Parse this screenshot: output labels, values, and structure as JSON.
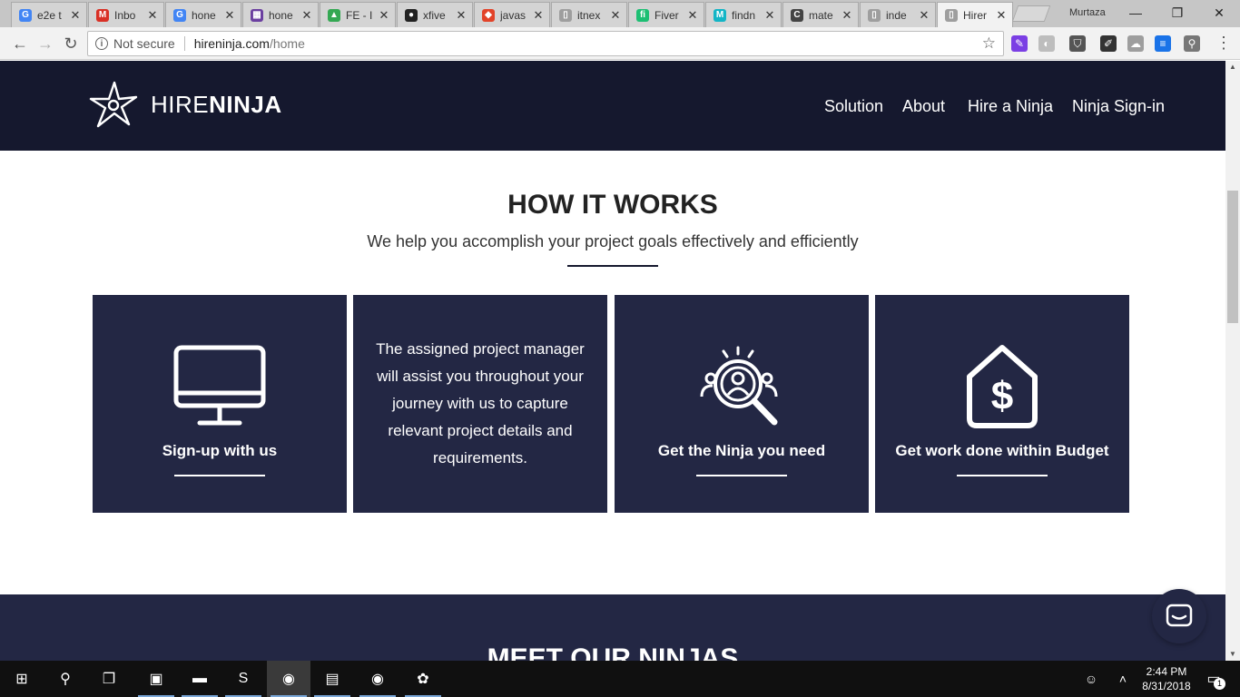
{
  "browser": {
    "tabs": [
      {
        "label": "e2e t",
        "icon": "google-icon",
        "color": "#4285f4",
        "glyph": "G"
      },
      {
        "label": "Inbo",
        "icon": "gmail-icon",
        "color": "#d93025",
        "glyph": "M"
      },
      {
        "label": "hone",
        "icon": "google-icon",
        "color": "#4285f4",
        "glyph": "G"
      },
      {
        "label": "hone",
        "icon": "hive-icon",
        "color": "#6b3fa0",
        "glyph": "▦"
      },
      {
        "label": "FE - I",
        "icon": "drive-icon",
        "color": "#34a853",
        "glyph": "▲"
      },
      {
        "label": "xfive",
        "icon": "github-icon",
        "color": "#222222",
        "glyph": "●"
      },
      {
        "label": "javas",
        "icon": "gitlab-icon",
        "color": "#e24329",
        "glyph": "◆"
      },
      {
        "label": "itnex",
        "icon": "page-icon",
        "color": "#9e9e9e",
        "glyph": "▯"
      },
      {
        "label": "Fiver",
        "icon": "fiverr-icon",
        "color": "#1dbf73",
        "glyph": "fi"
      },
      {
        "label": "findn",
        "icon": "findn-icon",
        "color": "#13b5c6",
        "glyph": "M"
      },
      {
        "label": "mate",
        "icon": "c-icon",
        "color": "#444444",
        "glyph": "C"
      },
      {
        "label": "inde",
        "icon": "page-icon",
        "color": "#9e9e9e",
        "glyph": "▯"
      },
      {
        "label": "Hirer",
        "icon": "page-icon",
        "color": "#9e9e9e",
        "glyph": "▯"
      }
    ],
    "close_glyph": "✕",
    "username": "Murtaza",
    "window_controls": [
      "—",
      "❐",
      "✕"
    ],
    "nav": {
      "back": "←",
      "forward": "→",
      "reload": "↻"
    },
    "address": {
      "security_label": "Not secure",
      "host": "hireninja.com",
      "path": "/home",
      "star": "☆"
    },
    "extensions": [
      {
        "name": "extension-purple-icon",
        "color": "#7b3fe4",
        "glyph": "✎"
      },
      {
        "name": "extension-grey-icon",
        "color": "#bdbdbd",
        "glyph": "◐"
      },
      {
        "name": "extension-shield-icon",
        "color": "#555555",
        "glyph": "⛉"
      },
      {
        "name": "extension-picker-icon",
        "color": "#333333",
        "glyph": "✐"
      },
      {
        "name": "extension-cloud-icon",
        "color": "#9e9e9e",
        "glyph": "☁"
      },
      {
        "name": "extension-blue-icon",
        "color": "#1a73e8",
        "glyph": "≡"
      },
      {
        "name": "extension-bike-icon",
        "color": "#777777",
        "glyph": "⚲"
      }
    ],
    "menu_glyph": "⋮"
  },
  "site": {
    "colors": {
      "header_bg": "#15182e",
      "card_bg": "#232744"
    },
    "logo": {
      "light": "HIRE",
      "bold": "NINJA"
    },
    "nav": [
      "Solution",
      "About",
      "Hire a Ninja",
      "Ninja Sign-in"
    ],
    "how": {
      "title": "HOW IT WORKS",
      "subtitle": "We help you accomplish your project goals effectively and efficiently"
    },
    "cards": [
      {
        "icon": "monitor-icon",
        "title": "Sign-up with us"
      },
      {
        "description": "The assigned project manager will assist you throughout your journey with us to capture relevant project details and requirements."
      },
      {
        "icon": "search-people-icon",
        "title": "Get the Ninja you need"
      },
      {
        "icon": "dollar-tag-icon",
        "title": "Get work done within Budget"
      }
    ],
    "meet_title": "MEET OUR NINJAS"
  },
  "taskbar": {
    "apps": [
      {
        "name": "start-icon",
        "glyph": "⊞"
      },
      {
        "name": "search-icon",
        "glyph": "⚲"
      },
      {
        "name": "task-view-icon",
        "glyph": "❐"
      },
      {
        "name": "terminal-app-icon",
        "glyph": "▣"
      },
      {
        "name": "file-explorer-icon",
        "glyph": "▬"
      },
      {
        "name": "sublime-text-icon",
        "glyph": "S"
      },
      {
        "name": "chrome-icon",
        "glyph": "◉"
      },
      {
        "name": "sticky-notes-icon",
        "glyph": "▤"
      },
      {
        "name": "chrome-icon",
        "glyph": "◉"
      },
      {
        "name": "paint-app-icon",
        "glyph": "✿"
      }
    ],
    "time": "2:44 PM",
    "date": "8/31/2018",
    "notification_count": "1"
  }
}
